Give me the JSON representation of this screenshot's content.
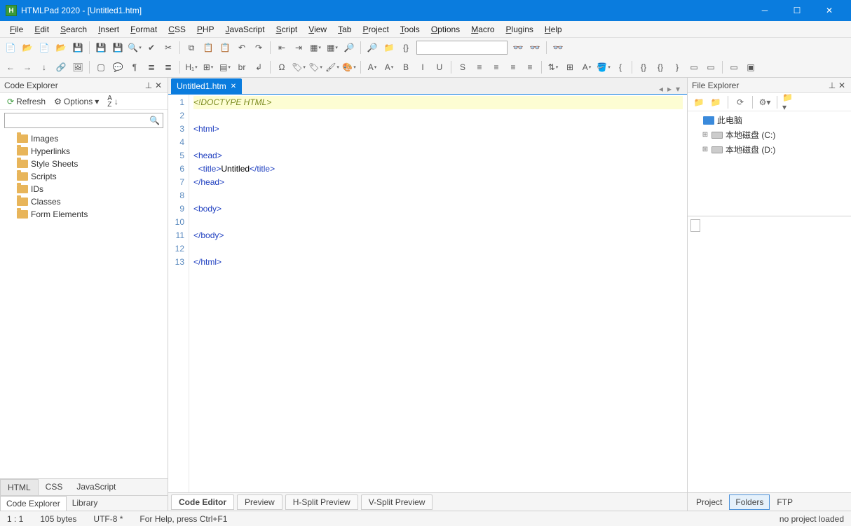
{
  "titlebar": {
    "title": "HTMLPad 2020 - [Untitled1.htm]"
  },
  "menu": [
    "File",
    "Edit",
    "Search",
    "Insert",
    "Format",
    "CSS",
    "PHP",
    "JavaScript",
    "Script",
    "View",
    "Tab",
    "Project",
    "Tools",
    "Options",
    "Macro",
    "Plugins",
    "Help"
  ],
  "left_panel": {
    "title": "Code Explorer",
    "refresh": "Refresh",
    "options": "Options",
    "items": [
      "Images",
      "Hyperlinks",
      "Style Sheets",
      "Scripts",
      "IDs",
      "Classes",
      "Form Elements"
    ],
    "lang_tabs": [
      "HTML",
      "CSS",
      "JavaScript"
    ],
    "bottom_tabs": [
      "Code Explorer",
      "Library"
    ]
  },
  "editor": {
    "tab": "Untitled1.htm",
    "lines": [
      {
        "n": 1,
        "kind": "decl",
        "text": "<!DOCTYPE HTML>"
      },
      {
        "n": 2,
        "kind": "",
        "text": ""
      },
      {
        "n": 3,
        "kind": "tag",
        "text": "<html>"
      },
      {
        "n": 4,
        "kind": "",
        "text": ""
      },
      {
        "n": 5,
        "kind": "tag",
        "text": "<head>"
      },
      {
        "n": 6,
        "kind": "mixed",
        "pre": "  <title>",
        "mid": "Untitled",
        "post": "</title>"
      },
      {
        "n": 7,
        "kind": "tag",
        "text": "</head>"
      },
      {
        "n": 8,
        "kind": "",
        "text": ""
      },
      {
        "n": 9,
        "kind": "tag",
        "text": "<body>"
      },
      {
        "n": 10,
        "kind": "",
        "text": ""
      },
      {
        "n": 11,
        "kind": "tag",
        "text": "</body>"
      },
      {
        "n": 12,
        "kind": "",
        "text": ""
      },
      {
        "n": 13,
        "kind": "tag",
        "text": "</html>"
      }
    ],
    "bottom_tabs": [
      "Code Editor",
      "Preview",
      "H-Split Preview",
      "V-Split Preview"
    ]
  },
  "right_panel": {
    "title": "File Explorer",
    "tree": [
      {
        "label": "此电脑",
        "type": "pc",
        "indent": 0,
        "exp": ""
      },
      {
        "label": "本地磁盘 (C:)",
        "type": "drive",
        "indent": 1,
        "exp": "⊞"
      },
      {
        "label": "本地磁盘 (D:)",
        "type": "drive",
        "indent": 1,
        "exp": "⊞"
      }
    ],
    "bottom_tabs": [
      "Project",
      "Folders",
      "FTP"
    ]
  },
  "statusbar": {
    "pos": "1 : 1",
    "size": "105 bytes",
    "encoding": "UTF-8 *",
    "help": "For Help, press Ctrl+F1",
    "project": "no project loaded"
  },
  "toolbar_icons_row1": [
    "new-file",
    "open-file",
    "orange-doc",
    "folder-open",
    "save",
    "save-all",
    "save-as",
    "search-dd",
    "spellcheck",
    "cut",
    "copy",
    "paste",
    "clipboard",
    "undo",
    "redo",
    "outdent",
    "indent",
    "layout-dd",
    "layout2-dd",
    "find",
    "find-replace",
    "folder-search",
    "braces",
    "binoculars1",
    "binoculars2",
    "binoculars3"
  ],
  "toolbar_icons_row2": [
    "back",
    "forward",
    "down",
    "link",
    "image",
    "box",
    "comment",
    "pilcrow",
    "list-ul",
    "list-ol",
    "h1-dd",
    "table-dd",
    "form-dd",
    "br",
    "arrow-turn",
    "omega",
    "tag-blue-dd",
    "tag-green-dd",
    "paint-dd",
    "palette-dd",
    "font-a-dd",
    "font-a-small-dd",
    "bold",
    "italic",
    "underline",
    "strike",
    "align-left",
    "align-center",
    "align-right",
    "align-justify",
    "line-spacing-dd",
    "table2",
    "font-color-dd",
    "bucket-dd",
    "brace-open",
    "braces",
    "brace-q",
    "brace-close",
    "panel1",
    "panel2",
    "panel3",
    "orange-box"
  ]
}
